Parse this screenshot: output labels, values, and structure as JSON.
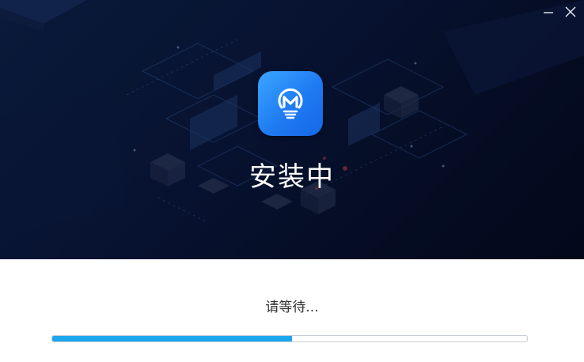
{
  "window": {
    "minimize_icon": "minimize-icon",
    "close_icon": "close-icon"
  },
  "header": {
    "logo_icon": "app-logo-m-lightbulb-icon",
    "title": "安装中"
  },
  "footer": {
    "status_text": "请等待...",
    "progress_fraction": 0.505
  },
  "colors": {
    "banner_bg": "#071230",
    "logo_accent": "#1f7bf2",
    "progress_fill": "#1ca7ec",
    "progress_track_border": "#c9ced6"
  }
}
